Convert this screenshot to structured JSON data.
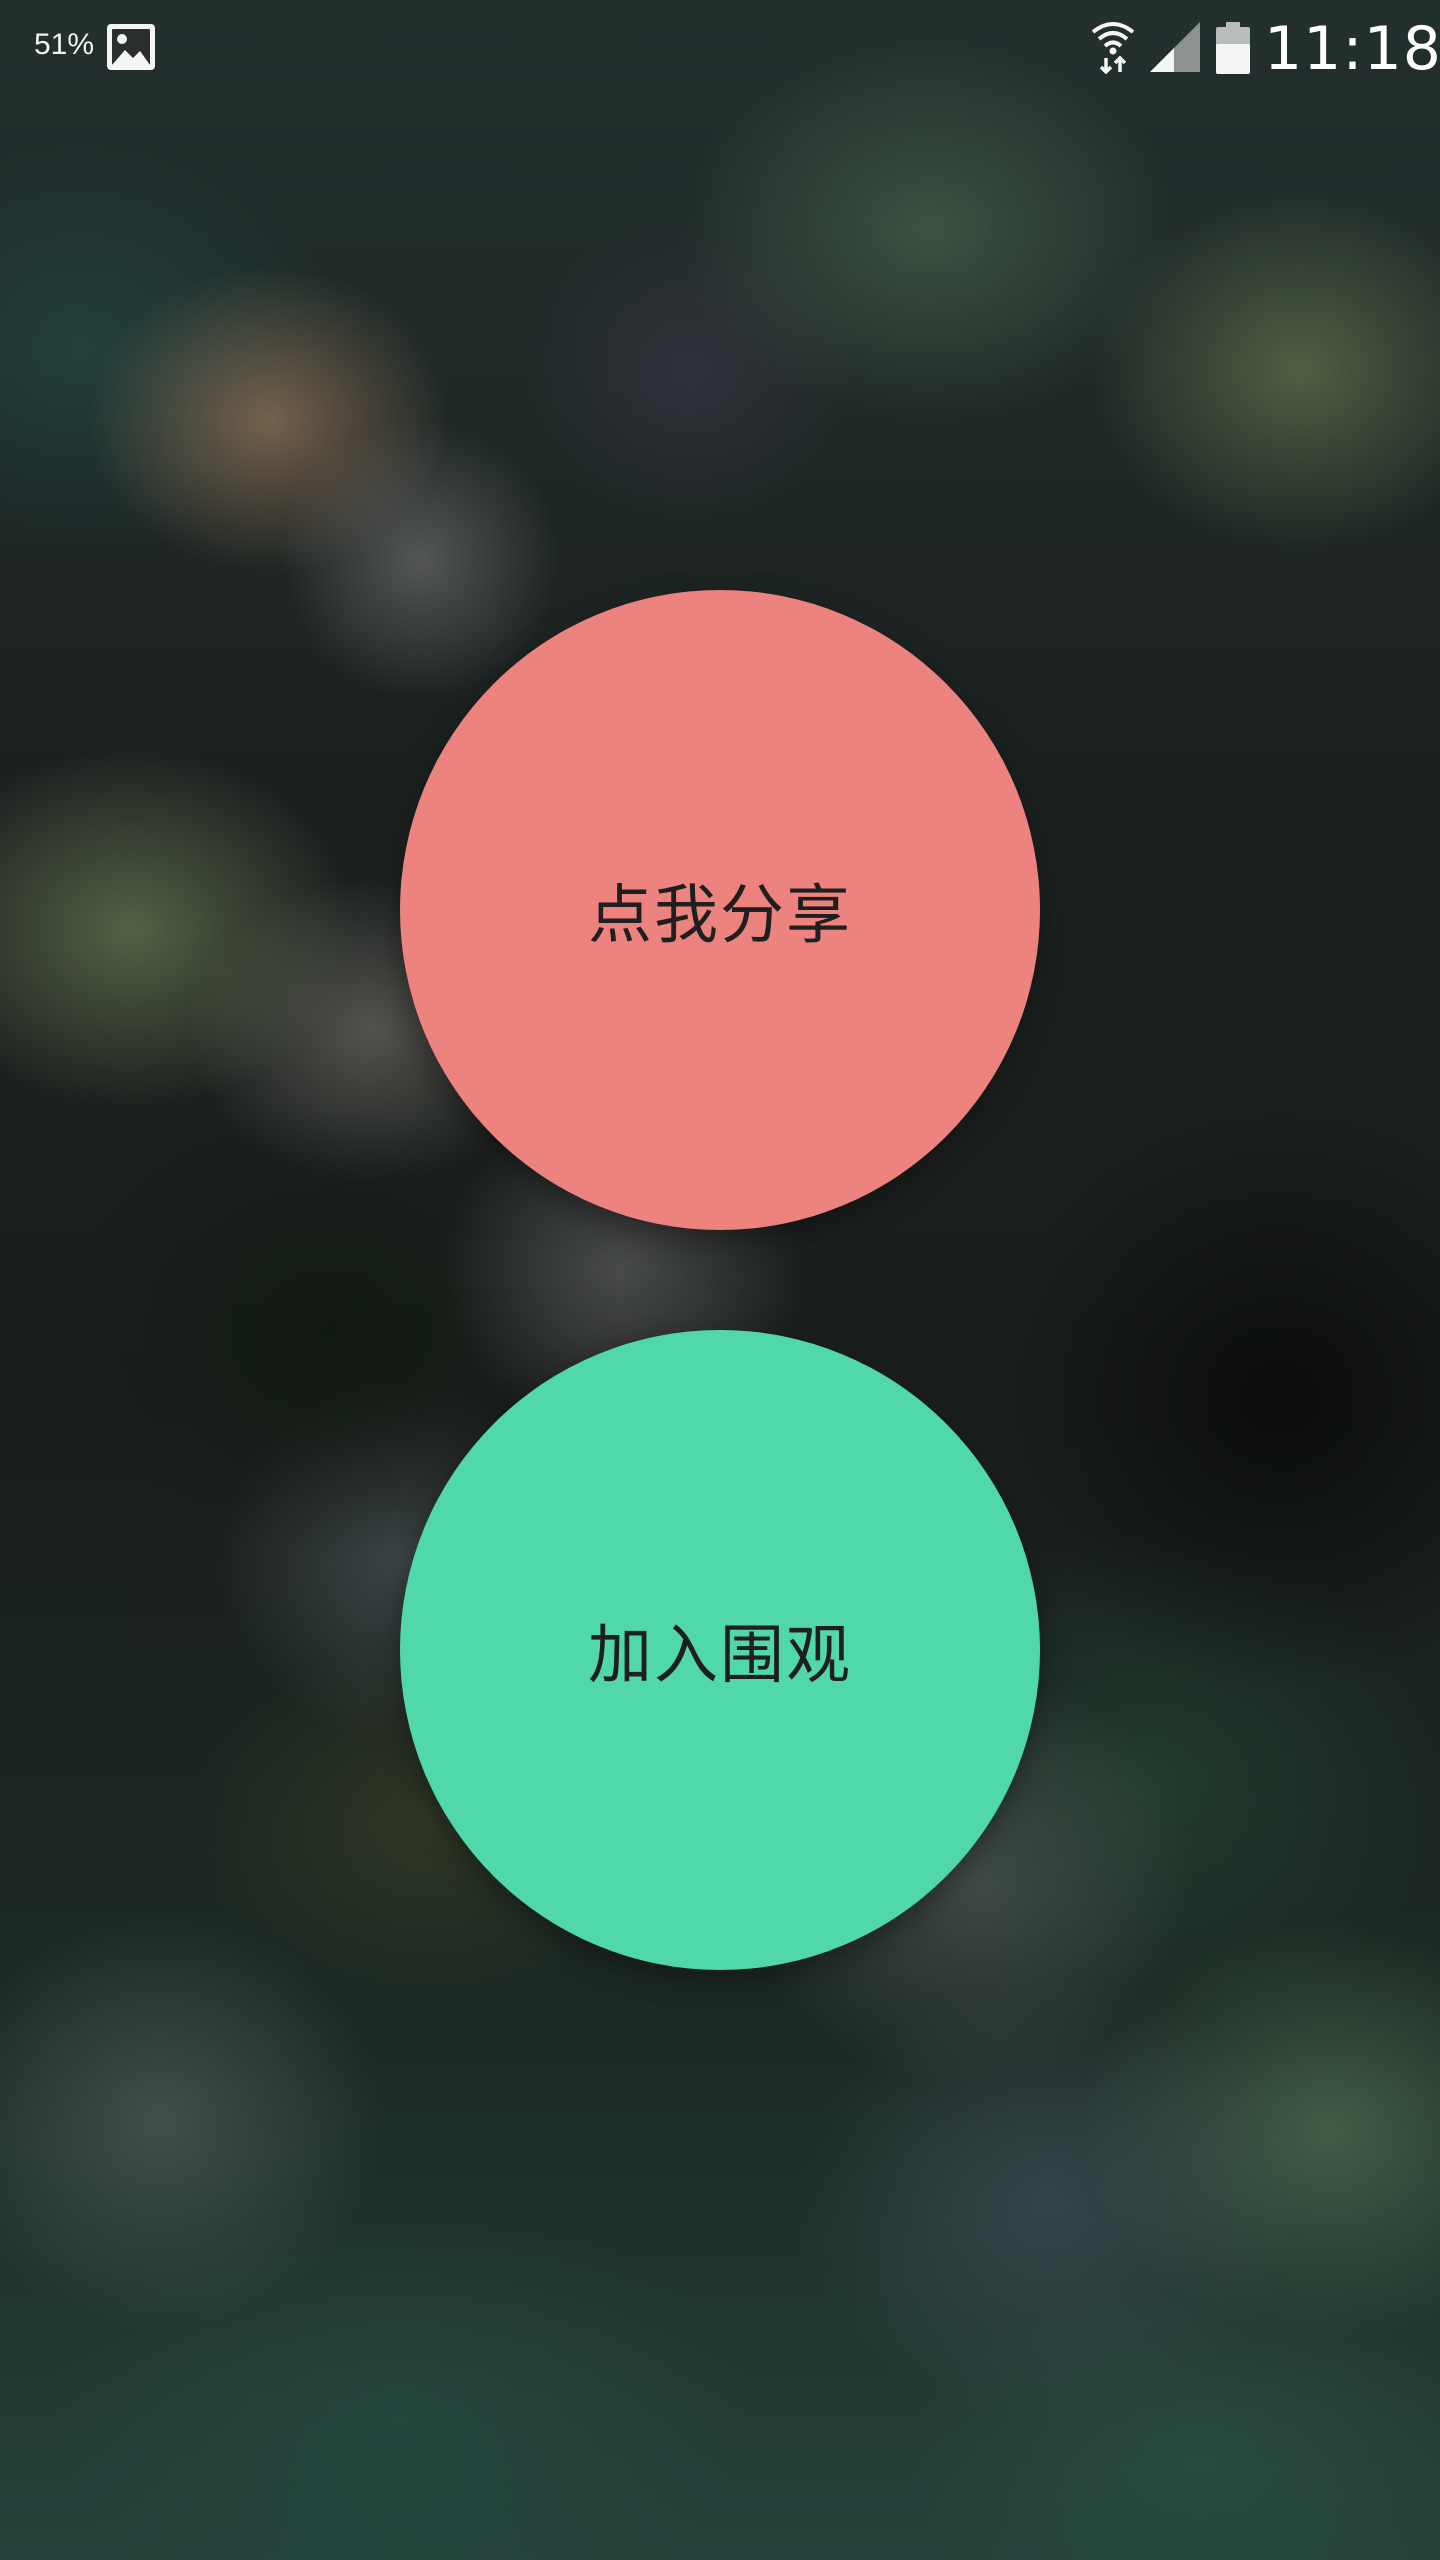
{
  "status_bar": {
    "battery_percent": "51%",
    "time": "11:18",
    "icons": [
      "image-icon",
      "wifi-icon",
      "signal-icon",
      "battery-icon"
    ]
  },
  "main": {
    "share_button": {
      "label": "点我分享",
      "color": "#ec837e"
    },
    "join_button": {
      "label": "加入围观",
      "color": "#50d8aa"
    }
  }
}
